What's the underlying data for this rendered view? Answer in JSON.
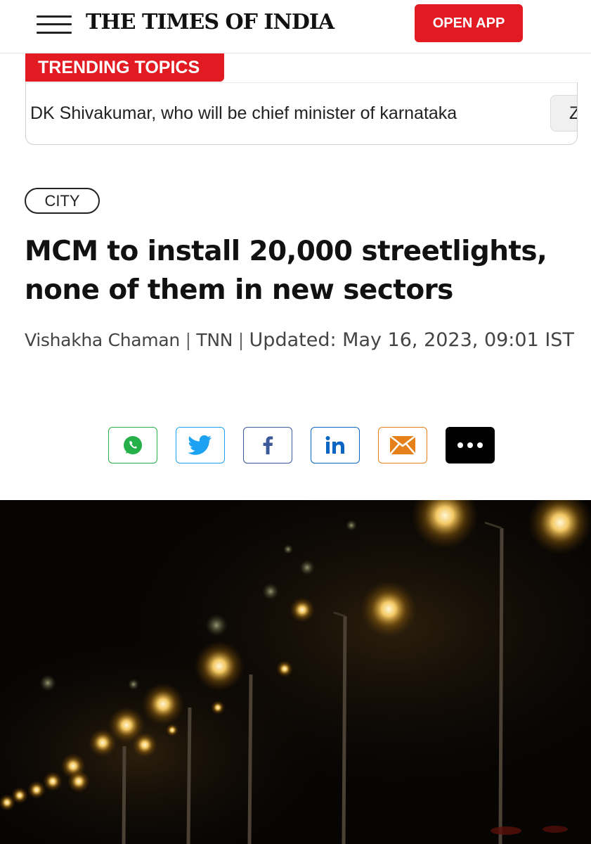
{
  "header": {
    "logo": "THE TIMES OF INDIA",
    "open_app_label": "OPEN APP",
    "accent_color": "#e21b22"
  },
  "trending": {
    "badge_label": "TRENDING TOPICS",
    "items": [
      "DK Shivakumar, who will be chief minister of karnataka",
      "Z"
    ]
  },
  "article": {
    "category": "CITY",
    "headline": "MCM to install 20,000 streetlights, none of them in new sectors",
    "author": "Vishakha Chaman",
    "agency": "TNN",
    "updated": "Updated: May 16, 2023, 09:01 IST"
  },
  "share": {
    "buttons": [
      {
        "name": "whatsapp",
        "icon": "whatsapp-icon",
        "color": "#25b04a"
      },
      {
        "name": "twitter",
        "icon": "twitter-icon",
        "color": "#1da1f2"
      },
      {
        "name": "facebook",
        "icon": "facebook-icon",
        "color": "#3b5998"
      },
      {
        "name": "linkedin",
        "icon": "linkedin-icon",
        "color": "#0a66c2"
      },
      {
        "name": "email",
        "icon": "email-icon",
        "color": "#e6801a"
      },
      {
        "name": "more",
        "icon": "more-icon",
        "color": "#000000"
      }
    ]
  }
}
